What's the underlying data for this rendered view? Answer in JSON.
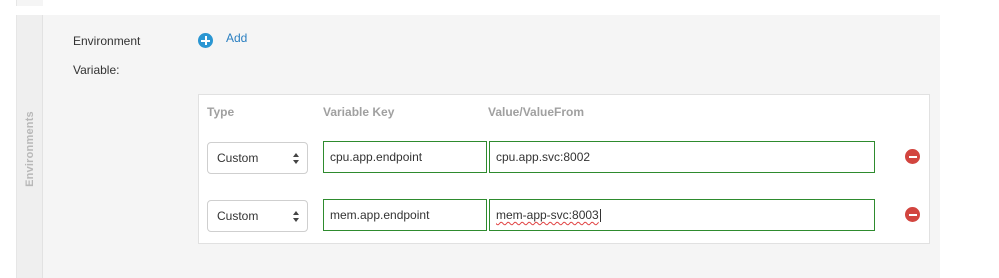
{
  "section": {
    "tab_label": "Environments",
    "field_label_line1": "Environment",
    "field_label_line2": "Variable:",
    "add_label": "Add"
  },
  "table": {
    "headers": {
      "type": "Type",
      "key": "Variable Key",
      "value": "Value/ValueFrom"
    },
    "rows": [
      {
        "type": "Custom",
        "key": "cpu.app.endpoint",
        "value": "cpu.app.svc:8002"
      },
      {
        "type": "Custom",
        "key": "mem.app.endpoint",
        "value": "mem-app-svc:8003"
      }
    ]
  },
  "colors": {
    "add_icon": "#2a96d2",
    "link": "#2a7fc1",
    "input_border_valid": "#2e8b2e",
    "remove_icon": "#d2453f",
    "header_text": "#a0a0a0"
  },
  "icons": {
    "add": "plus-circle-icon",
    "remove": "minus-circle-icon",
    "select": "chevron-up-down-icon"
  }
}
